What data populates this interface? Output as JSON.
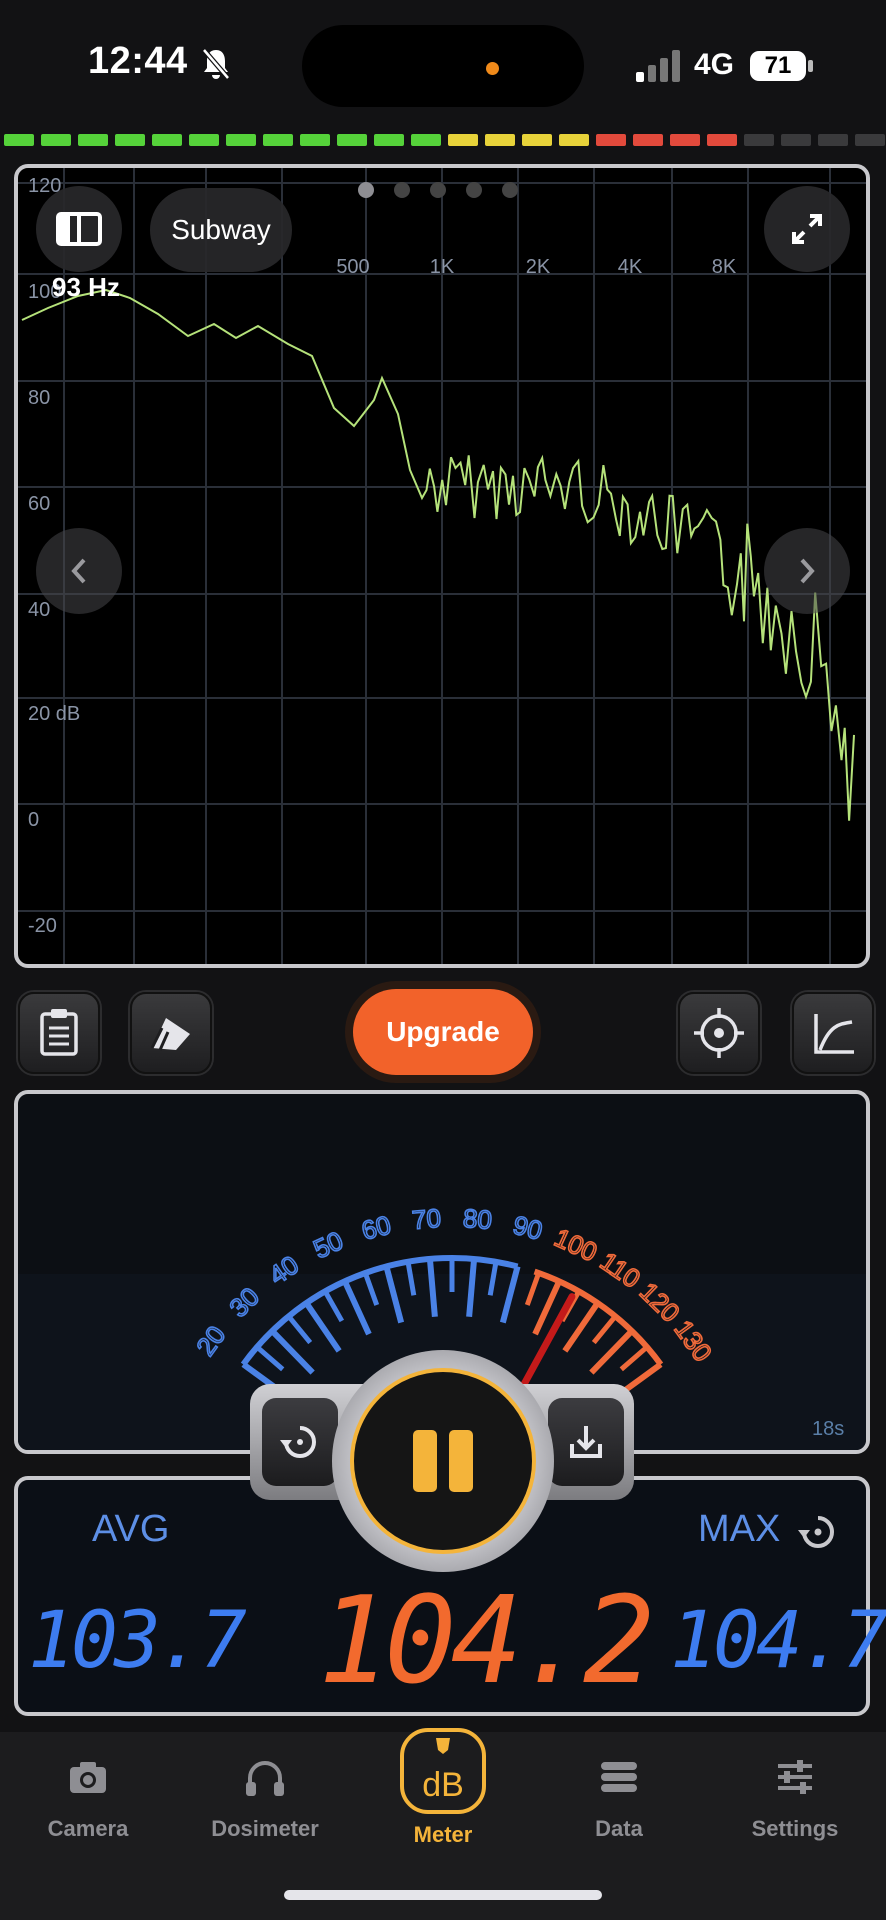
{
  "status": {
    "time": "12:44",
    "network": "4G",
    "battery": "71"
  },
  "spectrum": {
    "preset": "Subway",
    "peak_label": "93 Hz",
    "x_ticks": [
      "500",
      "1K",
      "2K",
      "4K",
      "8K"
    ],
    "y_ticks": [
      "120",
      "100",
      "80",
      "60",
      "40",
      "20 dB",
      "0",
      "-20"
    ]
  },
  "toolbar": {
    "upgrade_label": "Upgrade"
  },
  "gauge": {
    "scale": [
      "20",
      "30",
      "40",
      "50",
      "60",
      "70",
      "80",
      "90",
      "100",
      "110",
      "120",
      "130"
    ],
    "elapsed": "18s",
    "needle_db": 104.2
  },
  "readings": {
    "avg_label": "AVG",
    "avg_value": "103.7",
    "max_label": "MAX",
    "max_value": "104.7",
    "current_value": "104.2"
  },
  "tabs": [
    {
      "label": "Camera",
      "icon": "camera-icon"
    },
    {
      "label": "Dosimeter",
      "icon": "headphones-icon"
    },
    {
      "label": "Meter",
      "icon": "db-icon",
      "active": true
    },
    {
      "label": "Data",
      "icon": "database-icon"
    },
    {
      "label": "Settings",
      "icon": "sliders-icon"
    }
  ],
  "colors": {
    "accent": "#f4b43a",
    "orange": "#f26a2e",
    "blue": "#3d7cf0",
    "spectrum_line": "#b5e27a"
  }
}
